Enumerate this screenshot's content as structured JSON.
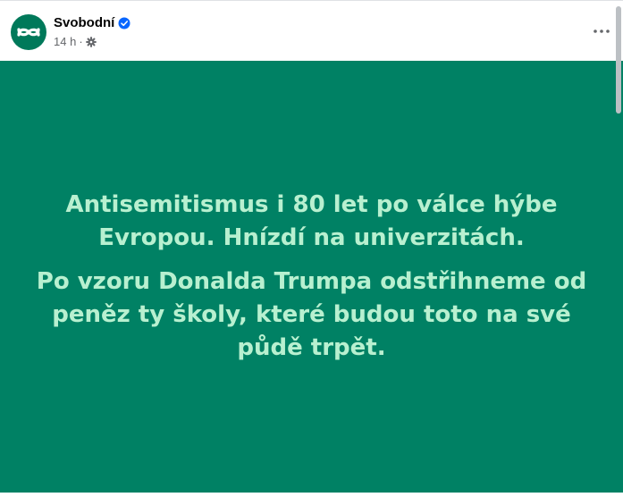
{
  "post": {
    "page_name": "Svobodní",
    "time": "14 h",
    "separator": "·",
    "paragraphs": [
      "Antisemitismus i 80 let po válce hýbe Evropou. Hnízdí na univerzitách.",
      "Po vzoru Donalda Trumpa odstřihneme od peněz ty školy, které budou toto na své půdě trpět."
    ]
  },
  "icons": {
    "avatar": "svobodni-logo-icon",
    "verified": "verified-badge-icon",
    "audience": "gear-icon",
    "more": "more-dots-icon"
  },
  "colors": {
    "avatar_bg": "#00795a",
    "post_bg": "#008164",
    "post_text": "#b8f0d0",
    "verified_blue": "#0866ff"
  }
}
